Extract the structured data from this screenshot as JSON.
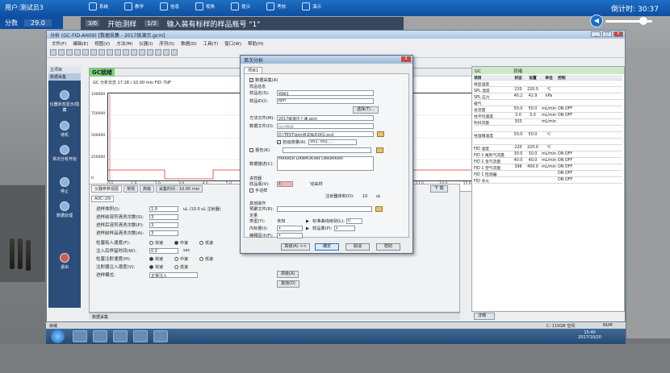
{
  "hud": {
    "user": "用户:测试员3",
    "score_label": "分数",
    "score_value": "29.0",
    "nav": [
      "系统",
      "教学",
      "信息",
      "视角",
      "提示",
      "考核",
      "演示"
    ],
    "timer": "倒计时: 30:37"
  },
  "instruction": {
    "step1": "3/6",
    "text1": "开始测样",
    "step2": "1/3",
    "text2": "输入装有标样的样品瓶号 \"1\""
  },
  "window": {
    "title": "分析 (GC-FID-AH09) [数据采集 - 2017级演示.gcm]",
    "menu": [
      "文件(F)",
      "编辑(E)",
      "视图(V)",
      "方法(M)",
      "仪器(I)",
      "序列(S)",
      "数据(D)",
      "工具(T)",
      "窗口(W)",
      "帮助(H)"
    ]
  },
  "sidenav": {
    "title": "主项目",
    "subtitle": "数据采集",
    "items": [
      "仪器状态显示/隐藏",
      "待机",
      "单次分析开始",
      "停止",
      "数据处理",
      "退出"
    ]
  },
  "gc_panel": {
    "status_badge": "GC就绪",
    "info_line": "GC  分析日志  17:28 / 10.00 min  FID  -TdF",
    "chart": {
      "y_ticks": [
        "100000",
        "750000",
        "500000",
        "250000",
        "0"
      ],
      "x_ticks": [
        "0.0",
        "1.0",
        "2.0",
        "3.0",
        "4.0",
        "5.0",
        "6.0",
        "7.0",
        "8.0",
        "9.0",
        "10.0",
        "11.0",
        "12.0",
        "13.0",
        "14.0",
        "15.0",
        "16.0"
      ],
      "x_unit": "min"
    }
  },
  "lower_panel": {
    "tabs": [
      "仪器参数视图",
      "常规",
      "高级"
    ],
    "tab_time": "采集时间 : 10.00 min",
    "next_label": "下 载",
    "subtabs": [
      "AOC-20i"
    ],
    "rows": [
      {
        "label": "进样体积(I):",
        "value": "1.0",
        "unit": "uL (10.0 uL 注射器)"
      },
      {
        "label": "进样前溶剂清洗次数(S):",
        "value": "3",
        "unit": ""
      },
      {
        "label": "进样后溶剂清洗次数(P):",
        "value": "3",
        "unit": ""
      },
      {
        "label": "进样前样品清洗次数(A):",
        "value": "3",
        "unit": ""
      }
    ],
    "radio_rows": [
      {
        "label": "柱塞吸入速度(F):",
        "options": [
          "快速",
          "中速",
          "低速"
        ],
        "selected": 1
      },
      {
        "label": "注入后停留时间(W):",
        "value": "0.2",
        "unit": "sec"
      },
      {
        "label": "柱塞注射速度(H):",
        "options": [
          "快速",
          "中速",
          "低速"
        ],
        "selected": 0
      },
      {
        "label": "注射器注入速度(V):",
        "options": [
          "快速",
          "低速"
        ],
        "selected": 0
      }
    ],
    "inject_mode_label": "进样模式:",
    "inject_mode_value": "正常注入",
    "btn_advanced": "高级(A)",
    "btn_other": "其他(O)",
    "bottom_tab": "数据采集"
  },
  "right_panel": {
    "title": "GC",
    "status": "就绪",
    "headers": [
      "项目",
      "状态",
      "设置",
      "单位",
      "控制"
    ],
    "rows": [
      [
        "样品温度",
        "",
        "",
        "",
        ""
      ],
      [
        "SPL 温度",
        "220",
        "220.0",
        "℃",
        ""
      ],
      [
        "SPL 压力",
        "40.2",
        "42.9",
        "kPa",
        ""
      ],
      [
        "载气",
        "",
        "",
        "",
        ""
      ],
      [
        "总流量",
        "50.0",
        "50.0",
        "mL/min",
        "ON OFF"
      ],
      [
        "柱平均速度",
        "3.0",
        "3.0",
        "mL/min",
        "ON OFF"
      ],
      [
        "吹扫流量",
        "303",
        "",
        "mL/min",
        ""
      ],
      [
        "",
        "",
        "",
        "",
        ""
      ],
      [
        "柱温箱温度",
        "50.0",
        "50.0",
        "℃",
        ""
      ],
      [
        "",
        "",
        "",
        "",
        ""
      ],
      [
        "FID 温度",
        "220",
        "220.0",
        "℃",
        ""
      ],
      [
        "FID 1 尾吹气流量",
        "30.0",
        "30.0",
        "mL/min",
        "ON OFF"
      ],
      [
        "FID 1 氢气流量",
        "40.0",
        "40.0",
        "mL/min",
        "ON OFF"
      ],
      [
        "FID 1 空气流量",
        "396",
        "400.0",
        "mL/min",
        "ON OFF"
      ],
      [
        "FID 1 检测器",
        "",
        "",
        "",
        "ON OFF"
      ],
      [
        "FID 点火",
        "",
        "",
        "",
        "ON OFF"
      ]
    ],
    "detail_button": "详细"
  },
  "dialog": {
    "title": "单次分析",
    "close": "X",
    "tab": "项目1",
    "data_collect": "数据采集(A)",
    "sample_section": "样品信息",
    "sample_name_label": "样品名(S):",
    "sample_name_value": "标样1",
    "sample_id_label": "样品ID(I):",
    "sample_id_value": "bjm",
    "select_btn": "选择(T)...",
    "method_file_label": "方法文件(M):",
    "method_file_value": "2017级演示上课.gcm",
    "data_file_label": "数据文件(D):",
    "data_file_value": "bjm数据",
    "data_path_value": "D:\\TEST\\bjm测试样品001.gcd",
    "auto_increment_label": "自动增量(A)",
    "auto_increment_value": "001, 002, ...",
    "report_label": "报告(R)",
    "data_desc_label": "数据描述(C):",
    "data_desc_value": "MARKER DANMOKIAN DANIAIKAN",
    "inject_section": "进样器",
    "vial_label": "样品瓶(V):",
    "vial_value": "1",
    "manual_label": "手进样",
    "tray_label": "自动采样",
    "inject_volume_label": "注射器体积(O):",
    "inject_volume_value": "10",
    "inject_volume_unit": "uL",
    "other_section": "其他操作",
    "preprocess_label": "预聚文件(R):",
    "quant_section": "定量",
    "type_label": "类型(Y):",
    "type_value": "未知",
    "std_label": "标准曲线级别(L):",
    "std_value": "0",
    "inner_label": "内标量(I):",
    "inner_value": "1",
    "sample_amount_label": "样品量(P):",
    "sample_amount_value": "1",
    "dilution_label": "稀释因子(F):",
    "dilution_value": "1",
    "buttons": [
      "高级(A) <<",
      "确定",
      "取消",
      "帮助"
    ]
  },
  "statusbar": {
    "left": "就绪",
    "mem": "C: 115GB 空闲",
    "num": "NUM"
  },
  "taskbar": {
    "time": "15:40",
    "date": "2017/10/20"
  }
}
